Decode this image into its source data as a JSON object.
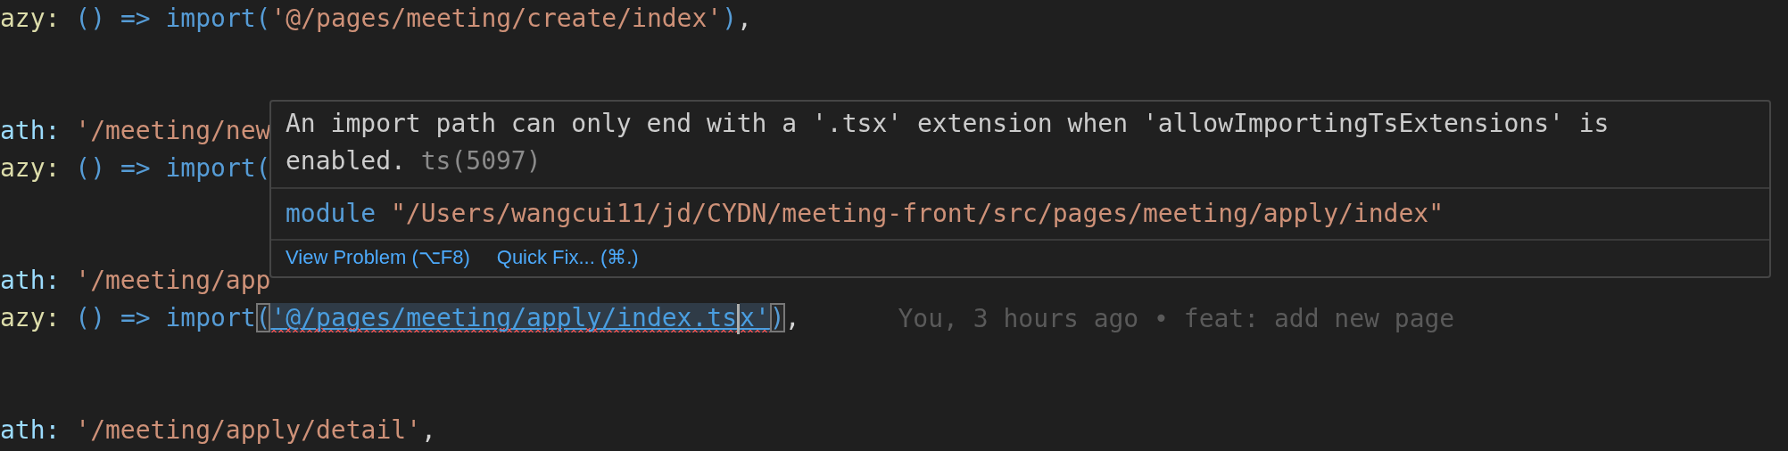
{
  "editor": {
    "lines": [
      {
        "kind": "code",
        "tokens": [
          {
            "kind": "method",
            "text": "azy:"
          },
          {
            "kind": "keyword",
            "text": "()"
          },
          {
            "kind": "keyword",
            "text": "=>"
          },
          {
            "kind": "keyword",
            "text": "import("
          },
          {
            "kind": "string",
            "text": "'@/pages/meeting/create/index'"
          },
          {
            "kind": "keyword",
            "text": ")"
          },
          {
            "kind": "punct",
            "text": ","
          }
        ]
      },
      {
        "kind": "blank"
      },
      {
        "kind": "blank"
      },
      {
        "kind": "code",
        "tokens": [
          {
            "kind": "property",
            "text": "ath:"
          },
          {
            "kind": "string",
            "text": "'/meeting/new"
          }
        ]
      },
      {
        "kind": "code",
        "tokens": [
          {
            "kind": "method",
            "text": "azy:"
          },
          {
            "kind": "keyword",
            "text": "()"
          },
          {
            "kind": "keyword",
            "text": "=>"
          },
          {
            "kind": "keyword",
            "text": "import("
          }
        ]
      },
      {
        "kind": "blank"
      },
      {
        "kind": "blank"
      },
      {
        "kind": "code",
        "tokens": [
          {
            "kind": "property",
            "text": "ath:"
          },
          {
            "kind": "string",
            "text": "'/meeting/app"
          }
        ]
      },
      {
        "kind": "code",
        "blame": "You, 3 hours ago • feat: add new page",
        "tokens": [
          {
            "kind": "method",
            "text": "azy:"
          },
          {
            "kind": "keyword",
            "text": "()"
          },
          {
            "kind": "keyword",
            "text": "=>"
          },
          {
            "kind": "keyword",
            "text": "import"
          },
          {
            "kind": "bracket",
            "text": "("
          },
          {
            "kind": "error-string",
            "text": "'@/pages/meeting/apply/index.ts"
          },
          {
            "kind": "cursor"
          },
          {
            "kind": "error-string",
            "text": "x'"
          },
          {
            "kind": "bracket",
            "text": ")"
          },
          {
            "kind": "punct",
            "text": ","
          }
        ]
      },
      {
        "kind": "blank"
      },
      {
        "kind": "blank"
      },
      {
        "kind": "code",
        "tokens": [
          {
            "kind": "property",
            "text": "ath:"
          },
          {
            "kind": "string",
            "text": "'/meeting/apply/detail'"
          },
          {
            "kind": "punct",
            "text": ","
          }
        ]
      }
    ]
  },
  "hover_popup": {
    "message": "An import path can only end with a '.tsx' extension when 'allowImportingTsExtensions' is enabled.",
    "code": "ts(5097)",
    "signature": {
      "keyword": "module",
      "path": "\"/Users/wangcui11/jd/CYDN/meeting-front/src/pages/meeting/apply/index\""
    },
    "actions": [
      "View Problem (⌥F8)",
      "Quick Fix... (⌘.)"
    ]
  }
}
